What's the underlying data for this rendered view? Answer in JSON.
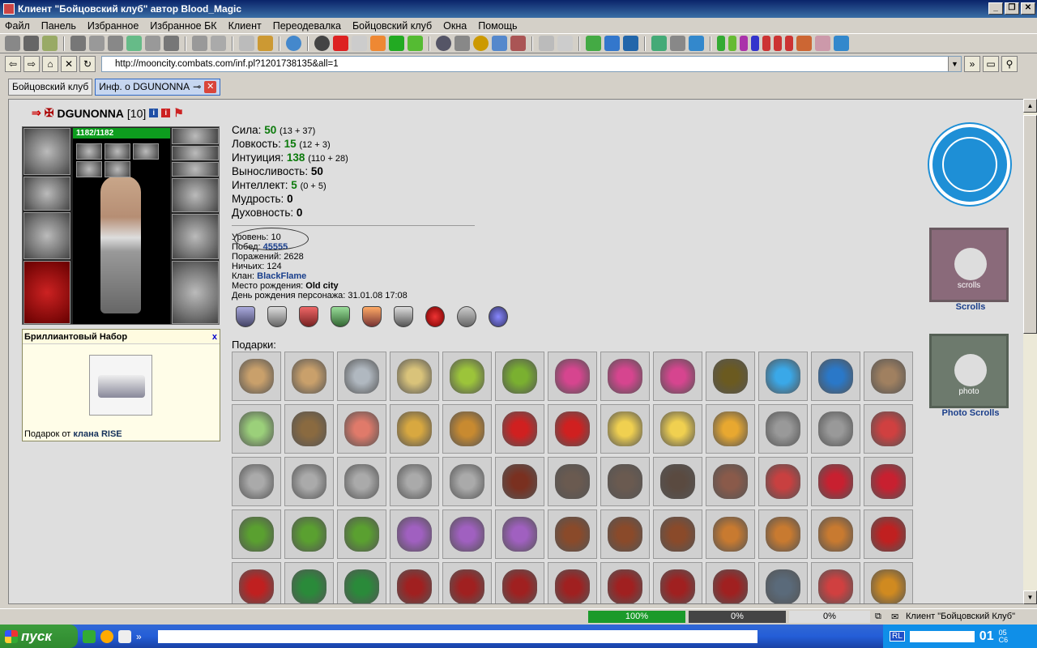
{
  "window": {
    "title": "Клиент \"Бойцовский клуб\" автор Blood_Magic"
  },
  "menu": [
    "Файл",
    "Панель",
    "Избранное",
    "Избранное БК",
    "Клиент",
    "Переодевалка",
    "Бойцовский клуб",
    "Окна",
    "Помощь"
  ],
  "address": {
    "url": "http://mooncity.combats.com/inf.pl?1201738135&all=1"
  },
  "tabs": [
    {
      "label": "Бойцовский клуб"
    },
    {
      "label": "Инф. о DGUNONNA"
    }
  ],
  "character": {
    "name": "DGUNONNA",
    "level": "[10]",
    "hp": "1182/1182"
  },
  "popup": {
    "title": "Бриллиантовый Набор",
    "close": "x",
    "from_prefix": "Подарок от",
    "from_clan": "клана RISE"
  },
  "stats": [
    {
      "label": "Сила:",
      "value": "50",
      "extra": "(13 + 37)"
    },
    {
      "label": "Ловкость:",
      "value": "15",
      "extra": "(12 + 3)"
    },
    {
      "label": "Интуиция:",
      "value": "138",
      "extra": "(110 + 28)"
    },
    {
      "label": "Выносливость:",
      "value": "50",
      "extra": ""
    },
    {
      "label": "Интеллект:",
      "value": "5",
      "extra": "(0 + 5)"
    },
    {
      "label": "Мудрость:",
      "value": "0",
      "extra": ""
    },
    {
      "label": "Духовность:",
      "value": "0",
      "extra": ""
    }
  ],
  "info": {
    "level": "Уровень: 10",
    "wins_label": "Побед:",
    "wins": "45555",
    "losses": "Поражений: 2628",
    "draws": "Ничьих: 124",
    "clan_label": "Клан:",
    "clan": "BlackFlame",
    "birthplace_label": "Место рождения:",
    "birthplace": "Old city",
    "birthday": "День рождения персонажа: 31.01.08 17:08"
  },
  "gifts_label": "Подарки:",
  "right": {
    "scrolls": "Scrolls",
    "scrolls_banner": "scrolls",
    "photo": "Photo Scrolls",
    "photo_banner": "photo"
  },
  "status": {
    "progress1": "100%",
    "progress2": "0%",
    "progress3": "0%",
    "client": "Клиент \"Бойцовский Клуб\""
  },
  "taskbar": {
    "start": "пуск",
    "lang": "RL",
    "time": "01",
    "time_small1": "05",
    "time_small2": "C6"
  },
  "colors": {
    "accent_green": "#0d9d1e",
    "link": "#183e8c",
    "title_blue": "#0a246a"
  }
}
